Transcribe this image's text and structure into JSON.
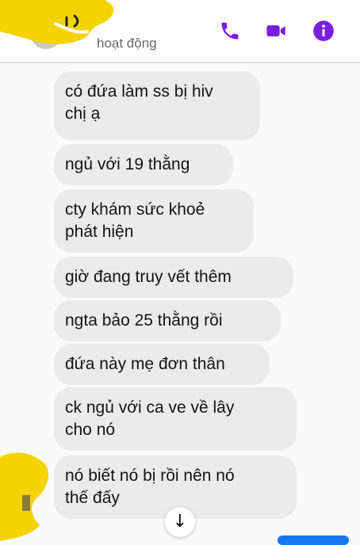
{
  "header": {
    "status_text": "hoạt động",
    "accent_color": "#7a1fe0",
    "icons": [
      "phone-icon",
      "video-call-icon",
      "info-icon"
    ]
  },
  "messages": [
    {
      "text": "có đứa làm ss bị hiv\nchị ạ"
    },
    {
      "text": "ngủ với 19 thằng"
    },
    {
      "text": "cty khám sức khoẻ\nphát hiện"
    },
    {
      "text": "giờ đang truy vết thêm"
    },
    {
      "text": "ngta bảo 25 thằng rồi"
    },
    {
      "text": "đứa này mẹ đơn thân"
    },
    {
      "text": "ck ngủ với ca ve về lây\ncho nó"
    },
    {
      "text": "nó biết nó bị rồi nên nó\nthế đấy"
    }
  ],
  "scroll_button": {
    "icon": "arrow-down-icon",
    "glyph": "↓"
  },
  "colors": {
    "bubble": "#ebebeb",
    "scribble": "#f5d300",
    "send": "#1877f2"
  }
}
